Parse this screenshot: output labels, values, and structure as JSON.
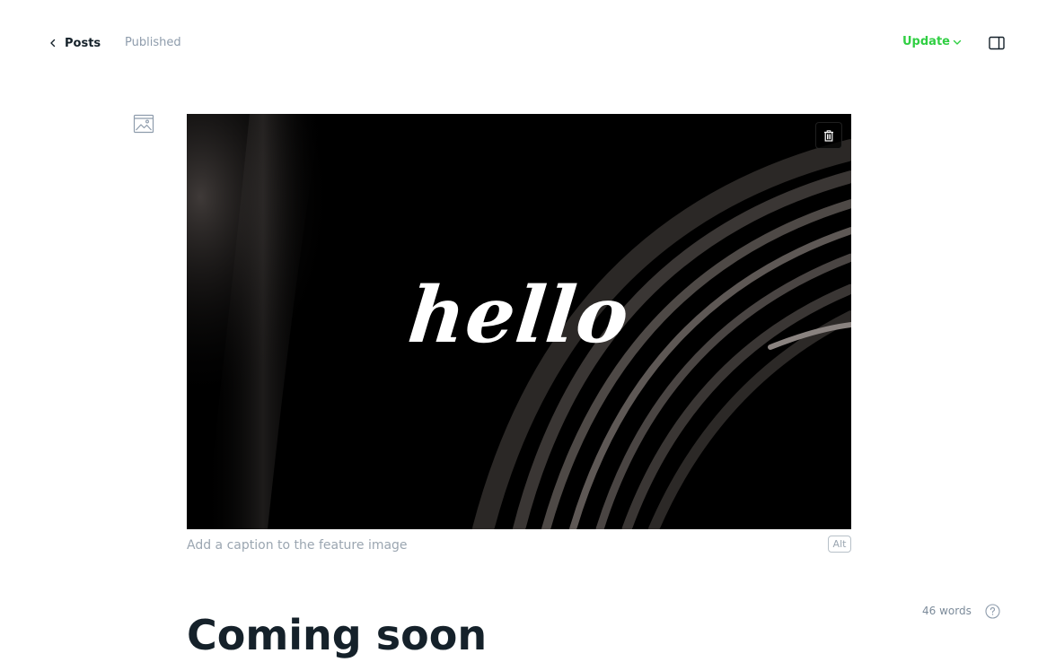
{
  "header": {
    "back_label": "Posts",
    "status": "Published",
    "update_label": "Update"
  },
  "icons": {
    "back": "chevron-left-icon",
    "update_dropdown": "chevron-down-icon",
    "sidebar_toggle": "sidebar-panel-icon",
    "image_tool": "image-icon",
    "delete": "trash-icon",
    "help": "question-circle-icon"
  },
  "feature_image": {
    "overlay_text": "hello",
    "caption_placeholder": "Add a caption to the feature image",
    "alt_label": "Alt"
  },
  "editor": {
    "word_count": "46 words",
    "title": "Coming soon"
  },
  "colors": {
    "accent_green": "#30cf43",
    "text_dark": "#15212a",
    "muted": "#8e9cac"
  }
}
